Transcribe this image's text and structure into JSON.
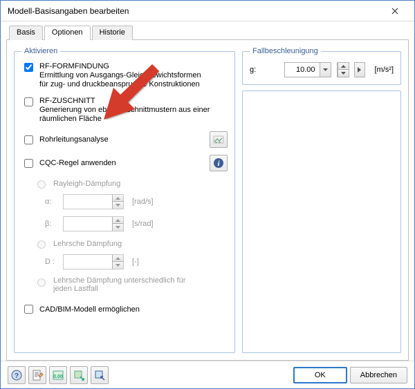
{
  "title": "Modell-Basisangaben bearbeiten",
  "tabs": {
    "basis": "Basis",
    "optionen": "Optionen",
    "historie": "Historie",
    "active": "Optionen"
  },
  "aktivieren": {
    "legend": "Aktivieren",
    "formfindung": {
      "title": "RF-FORMFINDUNG",
      "desc1": "Ermittlung von Ausgangs-Gleichgewichtsformen",
      "desc2": "für zug- und druckbeanspruchte Konstruktionen",
      "checked": true
    },
    "zuschnitt": {
      "title": "RF-ZUSCHNITT",
      "desc1": "Generierung von ebenen Schnittmustern aus einer",
      "desc2": "räumlichen Fläche",
      "checked": false
    },
    "rohr": {
      "label": "Rohrleitungsanalyse",
      "checked": false
    },
    "cqc": {
      "label": "CQC-Regel anwenden",
      "checked": false,
      "rayleigh": "Rayleigh-Dämpfung",
      "alpha": "α:",
      "alpha_unit": "[rad/s]",
      "beta": "β:",
      "beta_unit": "[s/rad]",
      "lehrsche": "Lehrsche Dämpfung",
      "d": "D :",
      "d_unit": "[-]",
      "lehrsche_diff": "Lehrsche Dämpfung unterschiedlich für jeden Lastfall"
    },
    "cadbim": {
      "label": "CAD/BIM-Modell ermöglichen",
      "checked": false
    }
  },
  "accel": {
    "legend": "Fallbeschleunigung",
    "g_label": "g:",
    "g_value": "10.00",
    "g_unit": "[m/s²]"
  },
  "buttons": {
    "ok": "OK",
    "cancel": "Abbrechen"
  }
}
